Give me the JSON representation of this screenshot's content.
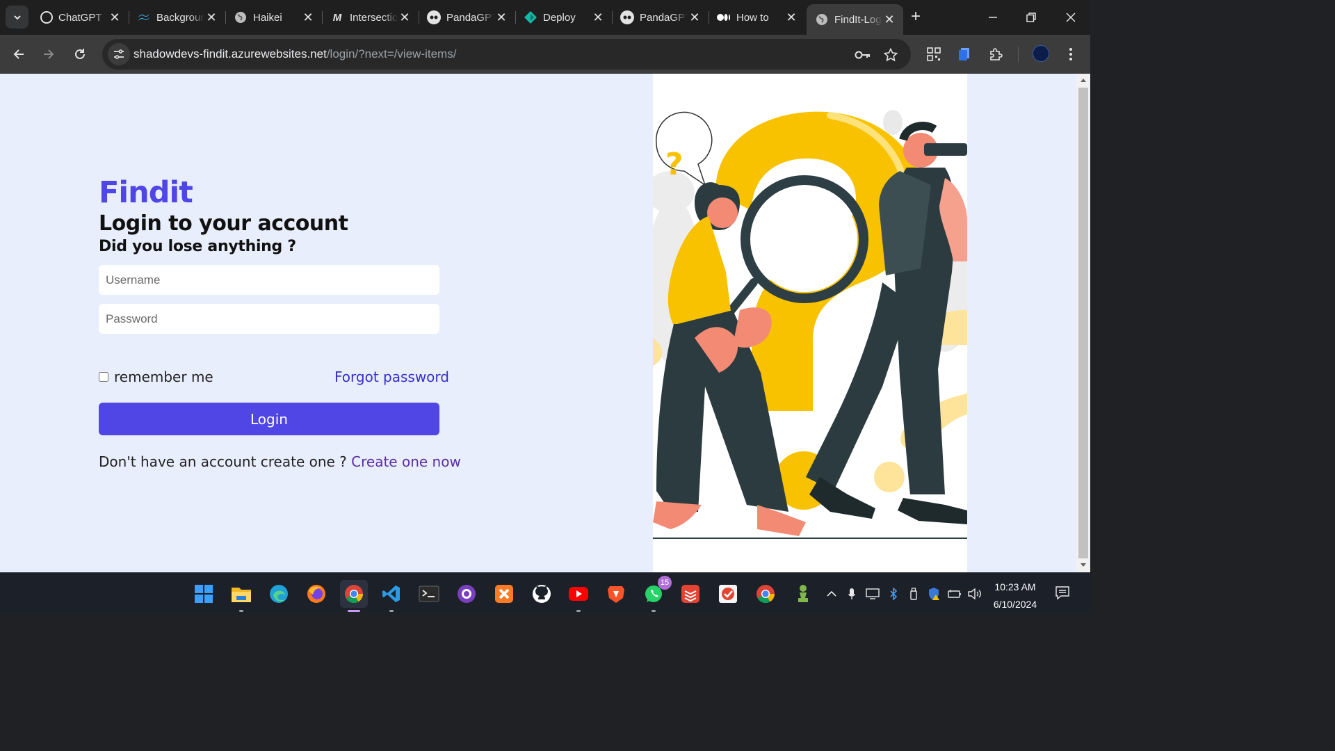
{
  "browser": {
    "tabs": [
      {
        "title": "ChatGPT",
        "favicon": "chatgpt-icon"
      },
      {
        "title": "Background",
        "favicon": "tailwind-icon"
      },
      {
        "title": "Haikei",
        "favicon": "globe-icon"
      },
      {
        "title": "Intersection",
        "favicon": "m-icon"
      },
      {
        "title": "PandaGPT",
        "favicon": "panda-icon"
      },
      {
        "title": "Deploy",
        "favicon": "deploy-icon"
      },
      {
        "title": "PandaGPT",
        "favicon": "panda-icon"
      },
      {
        "title": "How to",
        "favicon": "medium-icon"
      },
      {
        "title": "FindIt-Login",
        "favicon": "globe-icon"
      }
    ],
    "active_tab_index": 8,
    "url_host": "shadowdevs-findit.azurewebsites.net",
    "url_path": "/login/?next=/view-items/"
  },
  "page": {
    "logo": "Findit",
    "heading": "Login to your account",
    "subheading": "Did you lose anything ?",
    "username_placeholder": "Username",
    "password_placeholder": "Password",
    "remember_label": "remember me",
    "forgot_link": "Forgot password",
    "login_button": "Login",
    "signup_prompt": "Don't have an account create one ?",
    "signup_link": "Create one now"
  },
  "taskbar": {
    "apps": [
      "windows-start-icon",
      "file-explorer-icon",
      "edge-icon",
      "firefox-icon",
      "chrome-icon",
      "vscode-icon",
      "terminal-icon",
      "github-desktop-icon",
      "xampp-icon",
      "github-icon",
      "youtube-icon",
      "brave-icon",
      "whatsapp-icon",
      "todoist-icon",
      "tasks-icon",
      "chrome-icon",
      "chess-icon"
    ],
    "whatsapp_badge": "15",
    "time": "10:23 AM",
    "date": "6/10/2024"
  },
  "colors": {
    "accent": "#4f46e5",
    "link": "#3730c8",
    "page_bg": "#e8eefb",
    "illustration_yellow": "#f8c200"
  }
}
